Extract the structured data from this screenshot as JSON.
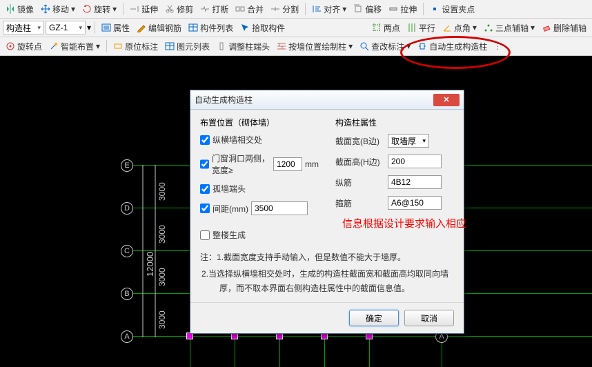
{
  "toolbar1": {
    "mirror": "镜像",
    "move": "移动",
    "rotate": "旋转",
    "extend": "延伸",
    "trim": "修剪",
    "break": "打断",
    "merge": "合并",
    "split": "分割",
    "align": "对齐",
    "offset": "偏移",
    "stretch": "拉伸",
    "setpoint": "设置夹点"
  },
  "toolbar2": {
    "dd1": "构造柱",
    "dd2": "GZ-1",
    "attr": "属性",
    "editrebar": "编辑钢筋",
    "memberlist": "构件列表",
    "pickmember": "拾取构件",
    "twopoint": "两点",
    "parallel": "平行",
    "angle": "点角",
    "threept": "三点辅轴",
    "delaux": "删除辅轴"
  },
  "toolbar3": {
    "rotpt": "旋转点",
    "smartplace": "智能布置",
    "markorig": "原位标注",
    "elemlist": "图元列表",
    "adjusthead": "调整柱端头",
    "drawbywall": "按墙位置绘制柱",
    "checkmark": "查改标注",
    "autogen": "自动生成构造柱"
  },
  "dialog": {
    "title": "自动生成构造柱",
    "left_title": "布置位置（砌体墙）",
    "cb1": "纵横墙相交处",
    "cb2": "门窗洞口两侧，宽度≥",
    "width_val": "1200",
    "width_unit": "mm",
    "cb3": "孤墙端头",
    "cb4": "间距(mm)",
    "spacing_val": "3500",
    "right_title": "构造柱属性",
    "sec_b_lbl": "截面宽(B边)",
    "sec_b_val": "取墙厚",
    "sec_h_lbl": "截面高(H边)",
    "sec_h_val": "200",
    "longbar_lbl": "纵筋",
    "longbar_val": "4B12",
    "stirrup_lbl": "箍筋",
    "stirrup_val": "A6@150",
    "whole": "整楼生成",
    "note_hdr": "注：",
    "note1": "1.截面宽度支持手动输入，但是数值不能大于墙厚。",
    "note2": "2.当选择纵横墙相交处时，生成的构造柱截面宽和截面高均取同向墙厚，而不取本界面右侧构造柱属性中的截面信息值。",
    "ok": "确定",
    "cancel": "取消"
  },
  "overlay": "信息根据设计要求输入相应",
  "axes": {
    "E": "E",
    "D": "D",
    "C": "C",
    "B": "B",
    "A": "A"
  },
  "dims": {
    "d3000": "3000",
    "d12000": "12000",
    "d3000b": "3000"
  }
}
